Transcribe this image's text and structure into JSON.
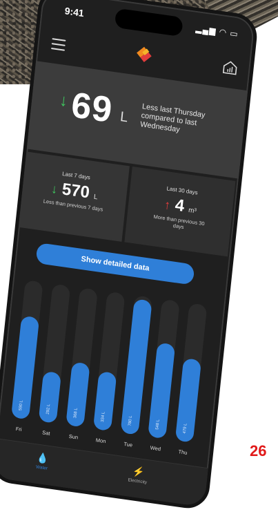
{
  "status": {
    "time": "9:41"
  },
  "hero": {
    "value": "69",
    "unit": "L",
    "note": "Less last Thursday compared to last Wednesday"
  },
  "stats": [
    {
      "label": "Last 7 days",
      "value": "570",
      "unit": "L",
      "note": "Less than previous 7 days",
      "trend": "down"
    },
    {
      "label": "Last 30 days",
      "value": "4",
      "unit": "m³",
      "note": "More than previous 30 days",
      "trend": "up"
    }
  ],
  "actions": {
    "detail_label": "Show detailed data"
  },
  "chart_data": {
    "type": "bar",
    "categories": [
      "Fri",
      "Sat",
      "Sun",
      "Mon",
      "Tue",
      "Wed",
      "Thu"
    ],
    "values": [
      590,
      292,
      368,
      334,
      780,
      548,
      479
    ],
    "value_labels": [
      "590 L",
      "292 L",
      "368 L",
      "334 L",
      "780 L",
      "548 L",
      "479 L"
    ],
    "max": 800
  },
  "tabs": [
    {
      "label": "Water",
      "icon": "water-drop-icon",
      "active": true
    },
    {
      "label": "Electricity",
      "icon": "lightning-icon",
      "active": false
    }
  ],
  "side_number": "26",
  "colors": {
    "accent": "#2f7fd8",
    "down": "#3fc45e",
    "up": "#e23c3c"
  }
}
